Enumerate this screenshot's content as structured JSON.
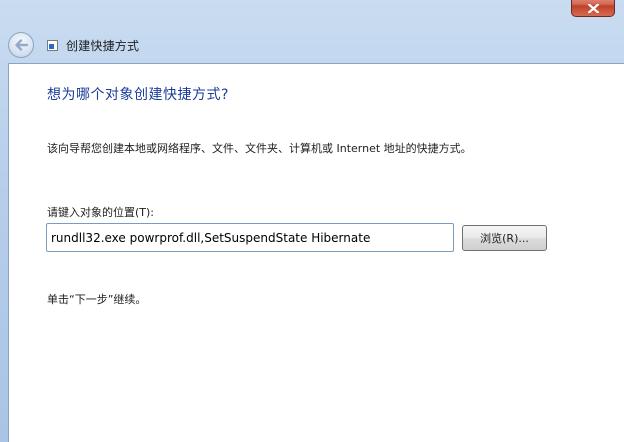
{
  "window": {
    "title": "创建快捷方式"
  },
  "icons": {
    "back": "back-arrow-icon",
    "shortcut": "shortcut-icon",
    "close": "close-icon"
  },
  "main": {
    "heading": "想为哪个对象创建快捷方式?",
    "description": "该向导帮您创建本地或网络程序、文件、文件夹、计算机或 Internet 地址的快捷方式。",
    "location_label": "请键入对象的位置(T):",
    "location_value": "rundll32.exe powrprof.dll,SetSuspendState Hibernate",
    "browse_label": "浏览(R)...",
    "hint": "单击“下一步”继续。"
  },
  "colors": {
    "heading": "#1b3c9a",
    "close_button": "#c0412b",
    "frame": "#b8cfea"
  }
}
